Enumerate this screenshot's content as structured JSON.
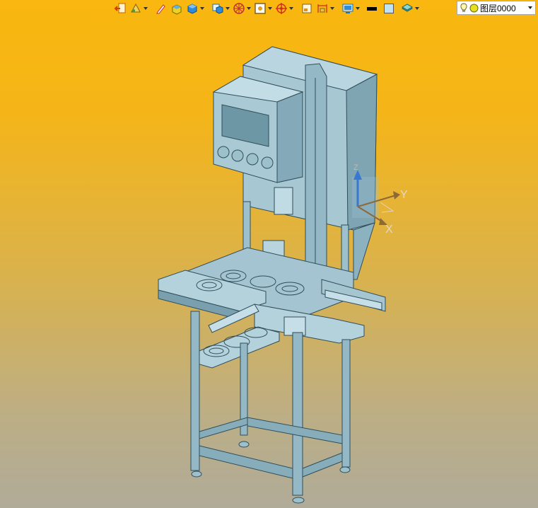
{
  "toolbar": {
    "buttons": [
      {
        "name": "exit-sketch-icon",
        "has_dropdown": false
      },
      {
        "name": "sketch-tools-icon",
        "has_dropdown": true
      },
      {
        "name": "pencil-icon",
        "has_dropdown": false
      },
      {
        "name": "extrude-icon",
        "has_dropdown": false
      },
      {
        "name": "solid-box-icon",
        "has_dropdown": true
      },
      {
        "name": "view-orientation-icon",
        "has_dropdown": true
      },
      {
        "name": "wheel-icon",
        "has_dropdown": true
      },
      {
        "name": "image-icon",
        "has_dropdown": true
      },
      {
        "name": "target-icon",
        "has_dropdown": true
      },
      {
        "name": "frame-icon",
        "has_dropdown": false
      },
      {
        "name": "measure-icon",
        "has_dropdown": true
      },
      {
        "name": "display-icon",
        "has_dropdown": true
      },
      {
        "name": "line-color-icon",
        "has_dropdown": false
      },
      {
        "name": "fill-color-icon",
        "has_dropdown": false
      },
      {
        "name": "layer-stack-icon",
        "has_dropdown": true
      }
    ],
    "line_color": "#000000",
    "fill_color": "#bfe3f5"
  },
  "layer": {
    "value": "图层0000",
    "bulb_icon": "bulb-icon",
    "status_icon": "yellow-circle-icon"
  },
  "triad": {
    "x_label": "X",
    "y_label": "Y",
    "z_label": "Z"
  },
  "colors": {
    "model": "#9dc0cd",
    "model_dark": "#6d96a5",
    "background_top": "#f9b70f",
    "background_bottom": "#b0ab99"
  }
}
